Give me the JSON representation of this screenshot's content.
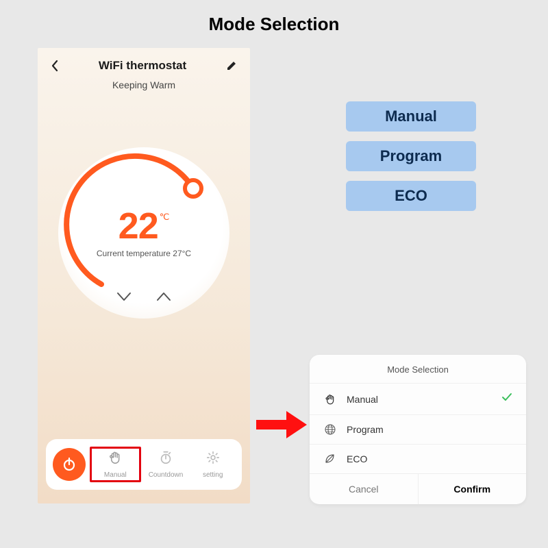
{
  "page_title": "Mode Selection",
  "phone": {
    "title": "WiFi thermostat",
    "status": "Keeping Warm",
    "set_temp": "22",
    "set_unit": "℃",
    "current_label": "Current temperature 27°C"
  },
  "toolbar": {
    "manual": "Manual",
    "countdown": "Countdown",
    "setting": "setting"
  },
  "mode_buttons": {
    "manual": "Manual",
    "program": "Program",
    "eco": "ECO"
  },
  "popup": {
    "title": "Mode Selection",
    "rows": {
      "manual": "Manual",
      "program": "Program",
      "eco": "ECO"
    },
    "cancel": "Cancel",
    "confirm": "Confirm"
  }
}
